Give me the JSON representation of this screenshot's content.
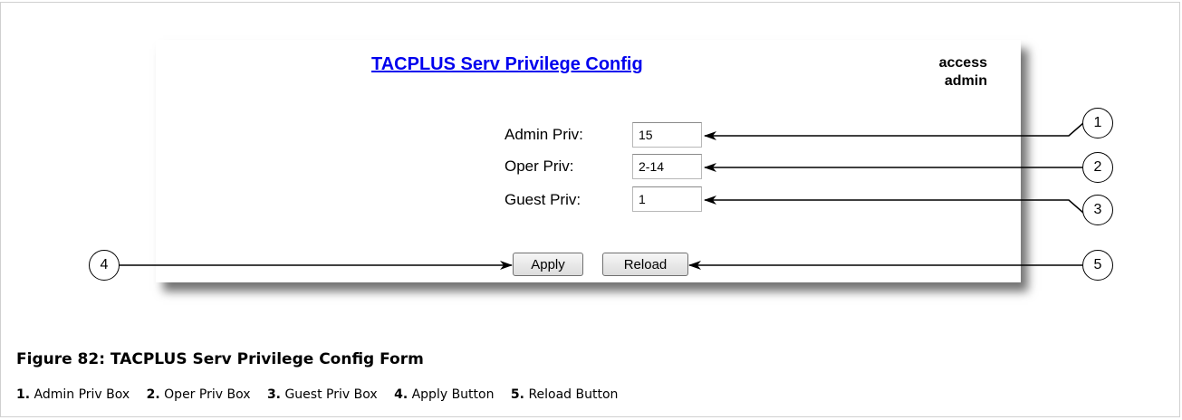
{
  "form": {
    "title": "TACPLUS Serv Privilege Config",
    "access_line1": "access",
    "access_line2": "admin",
    "fields": [
      {
        "label": "Admin Priv:",
        "value": "15"
      },
      {
        "label": "Oper Priv:",
        "value": "2-14"
      },
      {
        "label": "Guest Priv:",
        "value": "1"
      }
    ],
    "apply_label": "Apply",
    "reload_label": "Reload"
  },
  "callouts": [
    "1",
    "2",
    "3",
    "4",
    "5"
  ],
  "caption": {
    "title": "Figure 82: TACPLUS Serv Privilege Config Form",
    "legend": [
      {
        "num": "1.",
        "text": "Admin Priv Box"
      },
      {
        "num": "2.",
        "text": "Oper Priv Box"
      },
      {
        "num": "3.",
        "text": "Guest Priv Box"
      },
      {
        "num": "4.",
        "text": "Apply Button"
      },
      {
        "num": "5.",
        "text": "Reload Button"
      }
    ]
  }
}
